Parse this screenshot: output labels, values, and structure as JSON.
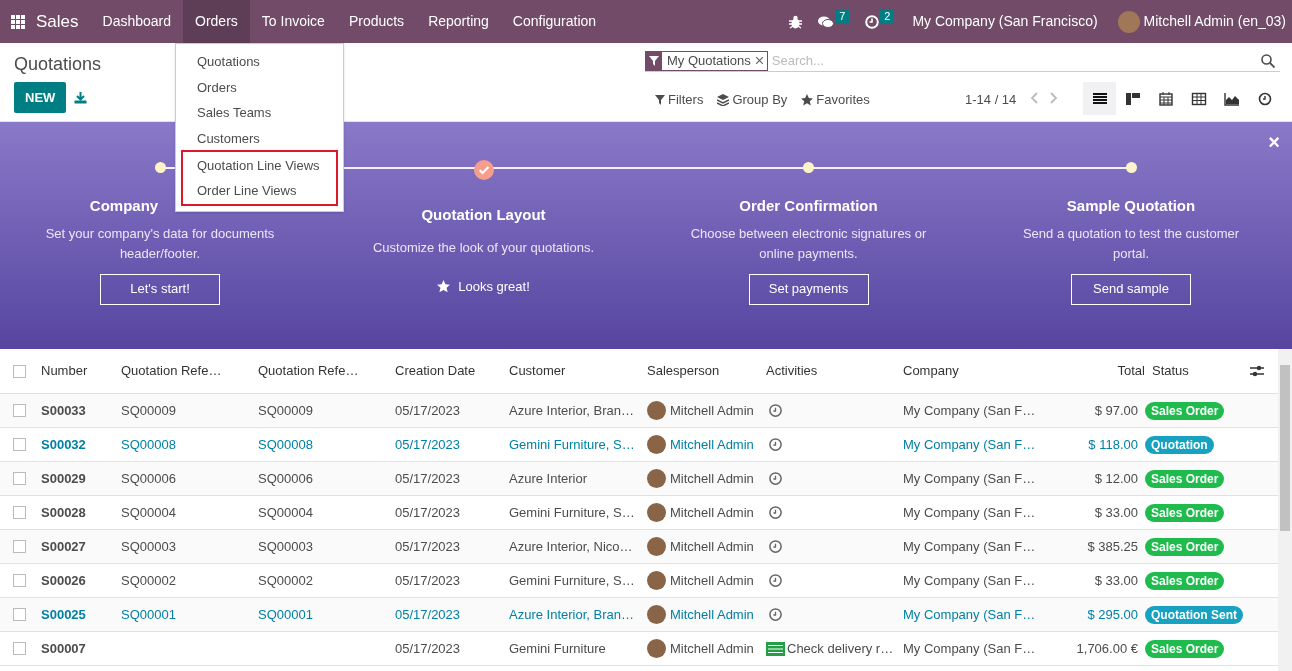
{
  "navbar": {
    "app": "Sales",
    "menus": [
      {
        "label": "Dashboard",
        "selected": false
      },
      {
        "label": "Orders",
        "selected": true
      },
      {
        "label": "To Invoice",
        "selected": false
      },
      {
        "label": "Products",
        "selected": false
      },
      {
        "label": "Reporting",
        "selected": false
      },
      {
        "label": "Configuration",
        "selected": false
      }
    ],
    "messages_count": "7",
    "activities_count": "2",
    "company": "My Company (San Francisco)",
    "user": "Mitchell Admin (en_03)"
  },
  "dropdown": {
    "items": [
      {
        "label": "Quotations",
        "boxed": false
      },
      {
        "label": "Orders",
        "boxed": false
      },
      {
        "label": "Sales Teams",
        "boxed": false
      },
      {
        "label": "Customers",
        "boxed": false
      },
      {
        "label": "Quotation Line Views",
        "boxed": true
      },
      {
        "label": "Order Line Views",
        "boxed": true
      }
    ]
  },
  "control_panel": {
    "title": "Quotations",
    "new_button": "NEW",
    "facet": "My Quotations",
    "search_placeholder": "Search...",
    "filters": "Filters",
    "group_by": "Group By",
    "favorites": "Favorites",
    "pager": "1-14 / 14",
    "views": [
      {
        "kind": "list",
        "selected": true
      },
      {
        "kind": "kanban",
        "selected": false
      },
      {
        "kind": "calendar",
        "selected": false
      },
      {
        "kind": "pivot",
        "selected": false
      },
      {
        "kind": "graph",
        "selected": false
      },
      {
        "kind": "activity",
        "selected": false
      }
    ]
  },
  "banner": {
    "close": "×",
    "steps": [
      {
        "kind": "todo",
        "title": "Company",
        "text": "Set your company's data for documents header/footer.",
        "action": "Let's start!"
      },
      {
        "kind": "done",
        "title": "Quotation Layout",
        "text": "Customize the look of your quotations.",
        "action": "Looks great!"
      },
      {
        "kind": "todo",
        "title": "Order Confirmation",
        "text": "Choose between electronic signatures or online payments.",
        "action": "Set payments"
      },
      {
        "kind": "todo",
        "title": "Sample Quotation",
        "text": "Send a quotation to test the customer portal.",
        "action": "Send sample"
      }
    ]
  },
  "table": {
    "select_all_checked": false,
    "columns": [
      "Number",
      "Quotation Refe…",
      "Quotation Refe…",
      "Creation Date",
      "Customer",
      "Salesperson",
      "Activities",
      "Company",
      "Total",
      "Status"
    ],
    "rows": [
      {
        "number": "S00033",
        "ref1": "SQ00009",
        "ref2": "SQ00009",
        "date": "05/17/2023",
        "customer": "Azure Interior, Bran…",
        "salesperson": "Mitchell Admin",
        "activity": {
          "kind": "clock"
        },
        "company": "My Company (San F…",
        "total": "$ 97.00",
        "status": "Sales Order",
        "kind": "sale",
        "checked": false
      },
      {
        "number": "S00032",
        "ref1": "SQ00008",
        "ref2": "SQ00008",
        "date": "05/17/2023",
        "customer": "Gemini Furniture, S…",
        "salesperson": "Mitchell Admin",
        "activity": {
          "kind": "clock"
        },
        "company": "My Company (San F…",
        "total": "$ 118.00",
        "status": "Quotation",
        "kind": "quotation",
        "checked": false
      },
      {
        "number": "S00029",
        "ref1": "SQ00006",
        "ref2": "SQ00006",
        "date": "05/17/2023",
        "customer": "Azure Interior",
        "salesperson": "Mitchell Admin",
        "activity": {
          "kind": "clock"
        },
        "company": "My Company (San F…",
        "total": "$ 12.00",
        "status": "Sales Order",
        "kind": "sale",
        "checked": false
      },
      {
        "number": "S00028",
        "ref1": "SQ00004",
        "ref2": "SQ00004",
        "date": "05/17/2023",
        "customer": "Gemini Furniture, S…",
        "salesperson": "Mitchell Admin",
        "activity": {
          "kind": "clock"
        },
        "company": "My Company (San F…",
        "total": "$ 33.00",
        "status": "Sales Order",
        "kind": "sale",
        "checked": false
      },
      {
        "number": "S00027",
        "ref1": "SQ00003",
        "ref2": "SQ00003",
        "date": "05/17/2023",
        "customer": "Azure Interior, Nico…",
        "salesperson": "Mitchell Admin",
        "activity": {
          "kind": "clock"
        },
        "company": "My Company (San F…",
        "total": "$ 385.25",
        "status": "Sales Order",
        "kind": "sale",
        "checked": false
      },
      {
        "number": "S00026",
        "ref1": "SQ00002",
        "ref2": "SQ00002",
        "date": "05/17/2023",
        "customer": "Gemini Furniture, S…",
        "salesperson": "Mitchell Admin",
        "activity": {
          "kind": "clock"
        },
        "company": "My Company (San F…",
        "total": "$ 33.00",
        "status": "Sales Order",
        "kind": "sale",
        "checked": false
      },
      {
        "number": "S00025",
        "ref1": "SQ00001",
        "ref2": "SQ00001",
        "date": "05/17/2023",
        "customer": "Azure Interior, Bran…",
        "salesperson": "Mitchell Admin",
        "activity": {
          "kind": "clock"
        },
        "company": "My Company (San F…",
        "total": "$ 295.00",
        "status": "Quotation Sent",
        "kind": "quotation",
        "checked": false
      },
      {
        "number": "S00007",
        "date": "05/17/2023",
        "customer": "Gemini Furniture",
        "salesperson": "Mitchell Admin",
        "activity": {
          "kind": "todo",
          "text": "Check delivery r…"
        },
        "company": "My Company (San F…",
        "total": "1,706.00 €",
        "status": "Sales Order",
        "kind": "sale",
        "checked": false
      }
    ]
  }
}
